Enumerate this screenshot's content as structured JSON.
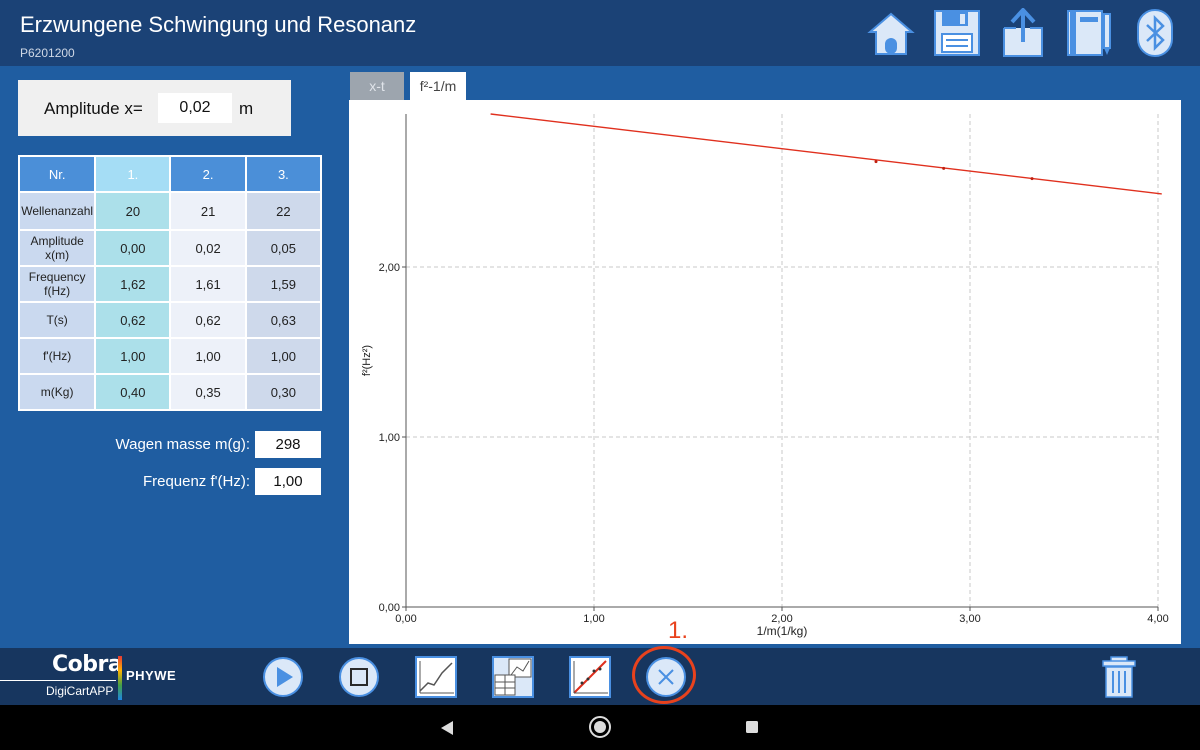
{
  "header": {
    "title": "Erzwungene Schwingung und Resonanz",
    "subtitle": "P6201200",
    "icons": [
      "home-icon",
      "save-icon",
      "share-icon",
      "notebook-icon",
      "bluetooth-icon"
    ]
  },
  "amplitude": {
    "label": "Amplitude  x=",
    "value": "0,02",
    "unit": "m"
  },
  "table": {
    "headers": [
      "Nr.",
      "1.",
      "2.",
      "3."
    ],
    "rows": [
      {
        "label": "Wellenanzahl",
        "values": [
          "20",
          "21",
          "22"
        ]
      },
      {
        "label": "Amplitude x(m)",
        "values": [
          "0,00",
          "0,02",
          "0,05"
        ]
      },
      {
        "label": "Frequency f(Hz)",
        "values": [
          "1,62",
          "1,61",
          "1,59"
        ]
      },
      {
        "label": "T(s)",
        "values": [
          "0,62",
          "0,62",
          "0,63"
        ]
      },
      {
        "label": "f'(Hz)",
        "values": [
          "1,00",
          "1,00",
          "1,00"
        ]
      },
      {
        "label": "m(Kg)",
        "values": [
          "0,40",
          "0,35",
          "0,30"
        ]
      }
    ]
  },
  "mass": {
    "label": "Wagen masse m(g):",
    "value": "298"
  },
  "freq": {
    "label": "Frequenz f'(Hz):",
    "value": "1,00"
  },
  "tabs": [
    {
      "label": "x-t",
      "active": false
    },
    {
      "label": "f²-1/m",
      "active": true
    }
  ],
  "chart_data": {
    "type": "line",
    "xlabel": "1/m(1/kg)",
    "ylabel": "f²(Hz²)",
    "xlim": [
      0,
      4
    ],
    "ylim": [
      0,
      2.9
    ],
    "xticks": [
      "0,00",
      "1,00",
      "2,00",
      "3,00",
      "4,00"
    ],
    "yticks": [
      "0,00",
      "1,00",
      "2,00"
    ],
    "grid": true,
    "series": [
      {
        "x": [
          0.45,
          4.02
        ],
        "y": [
          2.9,
          2.43
        ],
        "color": "#e0301e"
      }
    ],
    "points": [
      {
        "x": 2.5,
        "y": 2.62
      },
      {
        "x": 2.86,
        "y": 2.58
      },
      {
        "x": 3.33,
        "y": 2.52
      }
    ]
  },
  "toolbar": {
    "buttons": [
      "play-button",
      "stop-button",
      "graph-button",
      "table-graph-button",
      "fit-line-button",
      "clear-button"
    ],
    "delete": "delete-button"
  },
  "footer": {
    "brand": "Cobra",
    "app": "DigiCartAPP",
    "company": "PHYWE"
  },
  "annotation": {
    "label": "1."
  },
  "colors": {
    "header": "#1b4276",
    "content": "#1f5da1",
    "footer": "#17365f",
    "annot": "#e8421d",
    "line": "#e0301e"
  }
}
